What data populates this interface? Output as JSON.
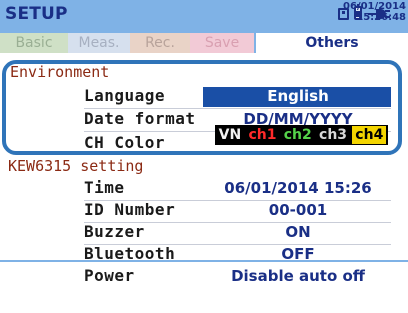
{
  "header": {
    "title": "SETUP",
    "date": "06/01/2014",
    "time": "15:26:48"
  },
  "tabs": [
    {
      "label": "Basic"
    },
    {
      "label": "Meas."
    },
    {
      "label": "Rec."
    },
    {
      "label": "Save"
    },
    {
      "label": "Others",
      "active": true
    }
  ],
  "environment": {
    "heading": "Environment",
    "language_label": "Language",
    "language_value": "English",
    "date_format_label": "Date format",
    "date_format_value": "DD/MM/YYYY",
    "ch_color_label": "CH Color",
    "ch_color_values": [
      "VN",
      "ch1",
      "ch2",
      "ch3",
      "ch4"
    ]
  },
  "device_setting": {
    "heading": "KEW6315 setting",
    "time_label": "Time",
    "time_value": "06/01/2014 15:26",
    "id_label": "ID Number",
    "id_value": "00-001",
    "buzzer_label": "Buzzer",
    "buzzer_value": "ON",
    "bluetooth_label": "Bluetooth",
    "bluetooth_value": "OFF",
    "power_label": "Power",
    "power_value": "Disable auto off"
  },
  "colors": {
    "title_bar": "#7fb2e6",
    "text_accent": "#1a2f86",
    "selection": "#1a4fa6",
    "callout_border": "#2f74b9",
    "section_heading": "#8b2a14"
  },
  "icons": [
    "sd-card-icon",
    "battery-icon",
    "ac-plug-icon"
  ]
}
